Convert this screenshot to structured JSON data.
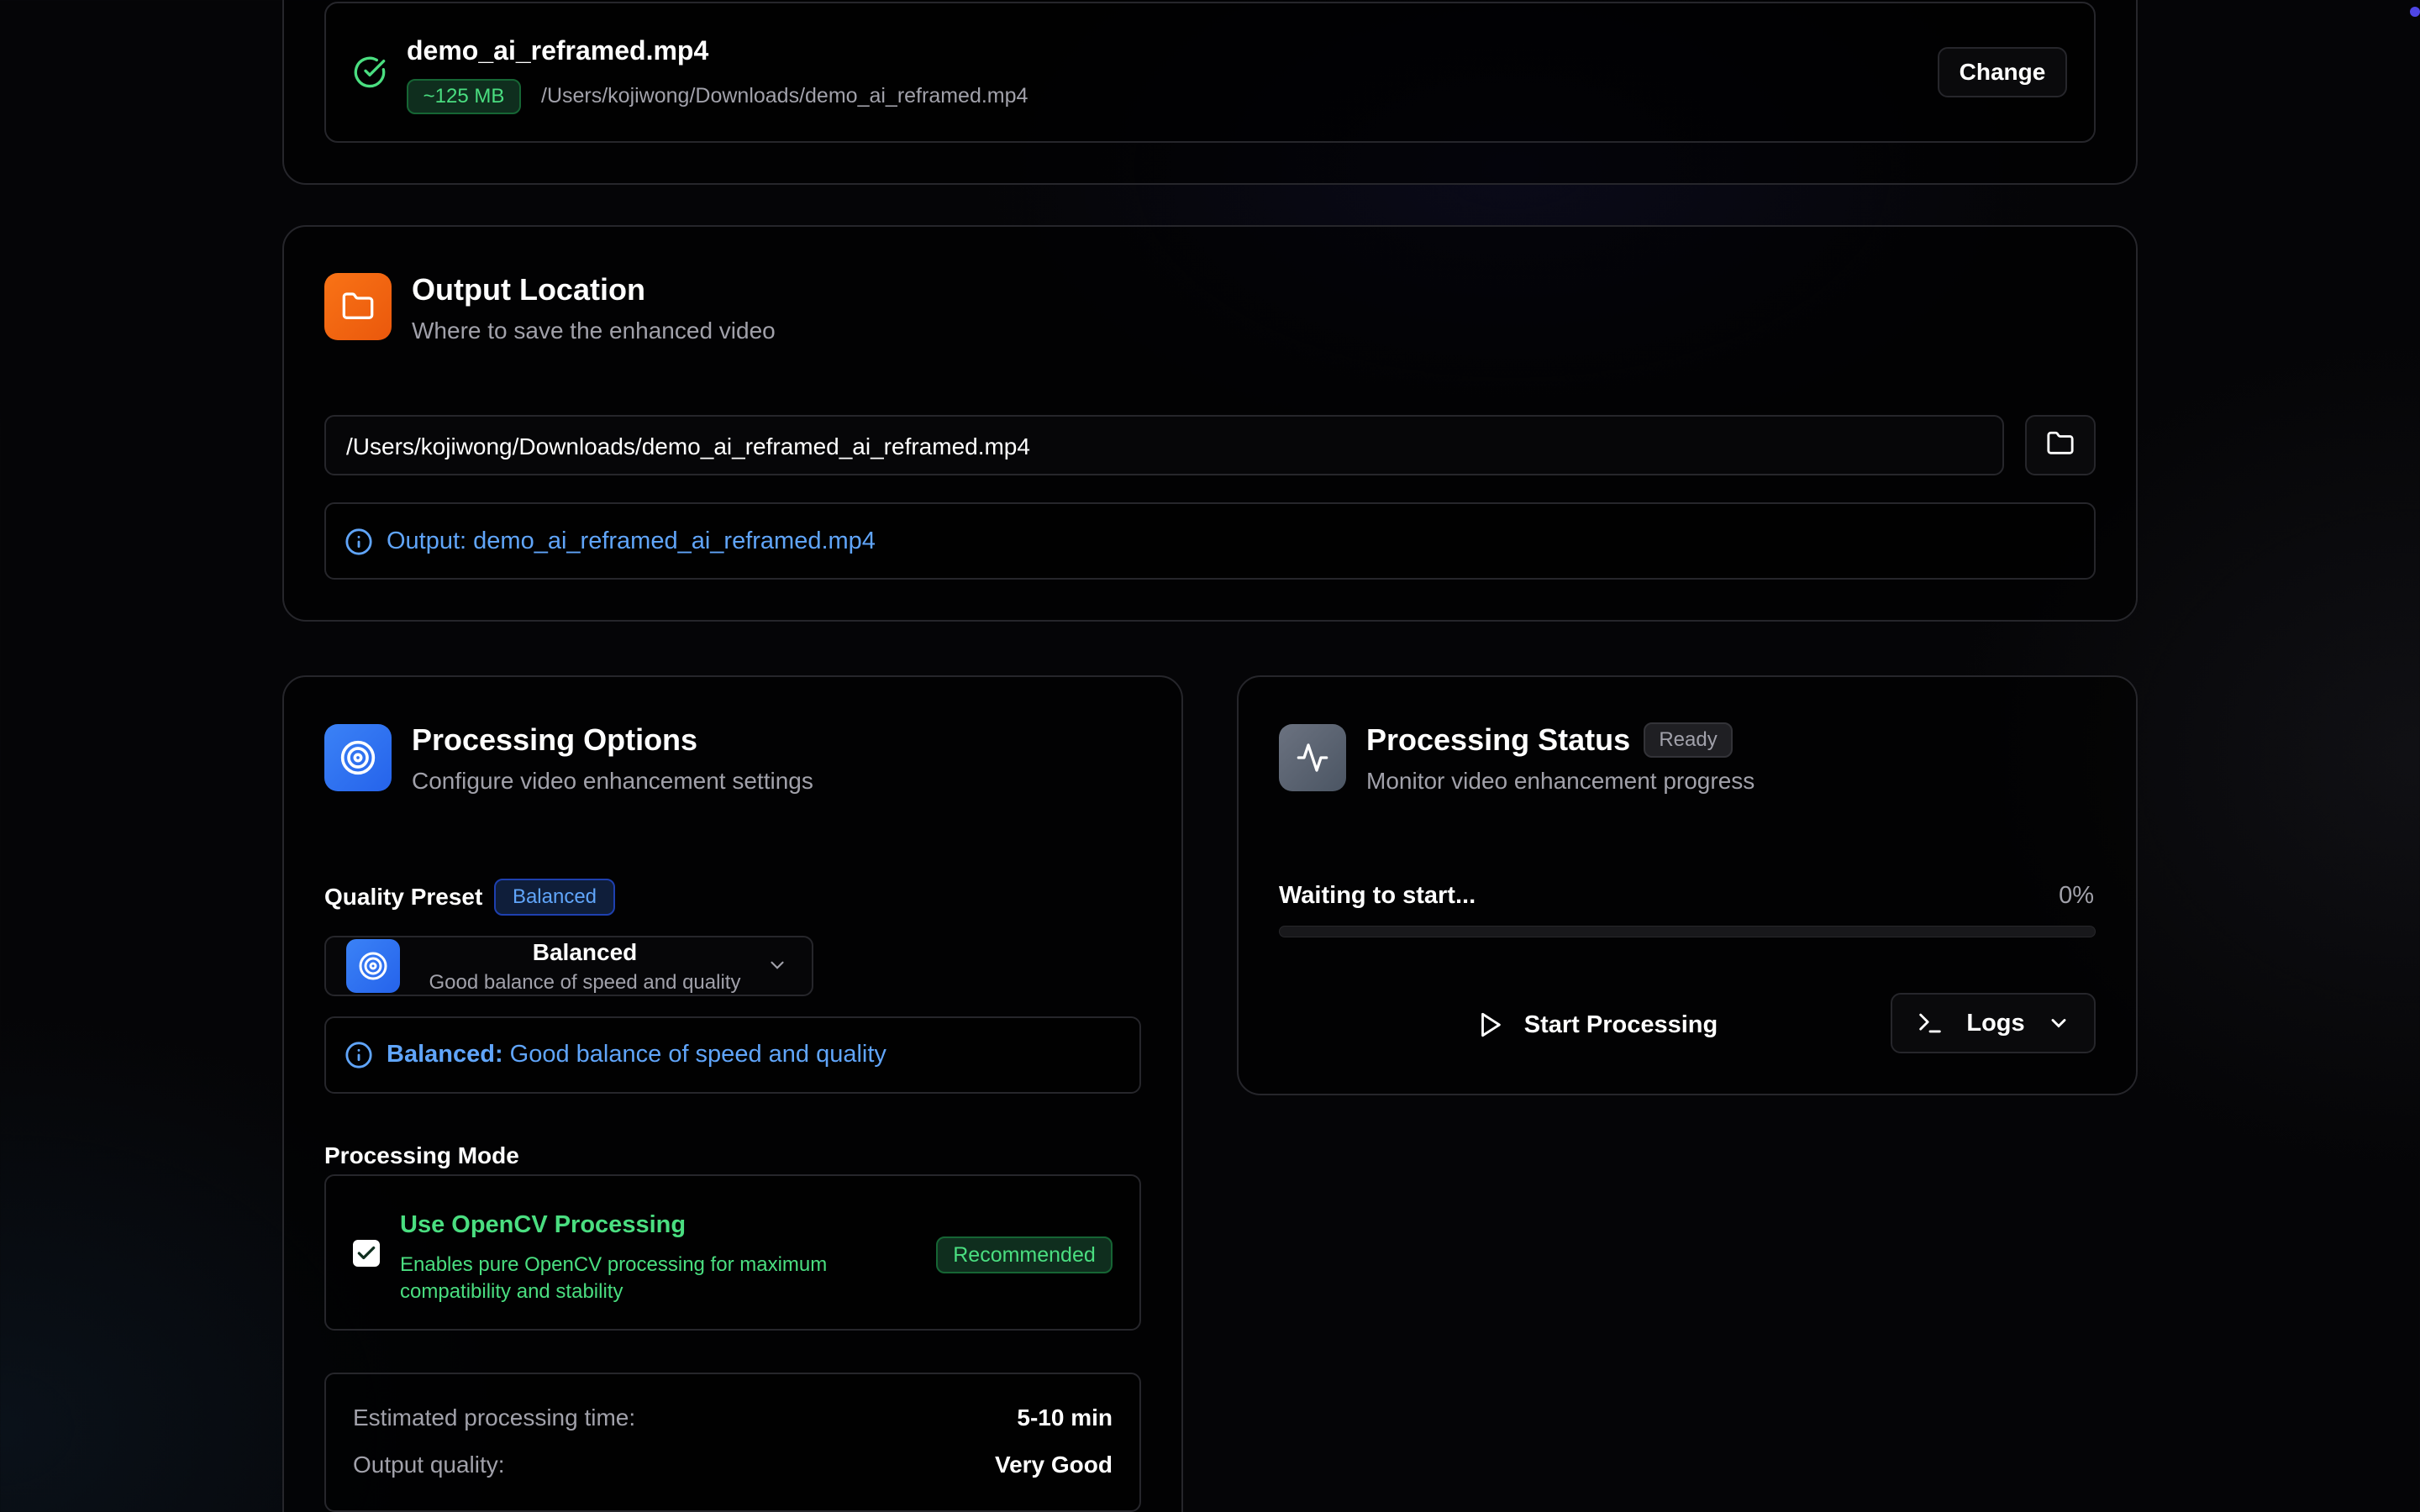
{
  "input_file": {
    "name": "demo_ai_reframed.mp4",
    "size_badge": "~125 MB",
    "path": "/Users/kojiwong/Downloads/demo_ai_reframed.mp4",
    "change_label": "Change"
  },
  "output": {
    "title": "Output Location",
    "subtitle": "Where to save the enhanced video",
    "path_value": "/Users/kojiwong/Downloads/demo_ai_reframed_ai_reframed.mp4",
    "info": "Output: demo_ai_reframed_ai_reframed.mp4"
  },
  "options": {
    "title": "Processing Options",
    "subtitle": "Configure video enhancement settings",
    "quality_label": "Quality Preset",
    "quality_badge": "Balanced",
    "select_title": "Balanced",
    "select_desc": "Good balance of speed and quality",
    "info_bold": "Balanced:",
    "info_text": "Good balance of speed and quality",
    "mode_label": "Processing Mode",
    "opencv_label": "Use OpenCV Processing",
    "opencv_desc_1": "Enables pure OpenCV processing for maximum",
    "opencv_desc_2": "compatibility and stability",
    "opencv_checked": true,
    "recommended": "Recommended",
    "est_time_label": "Estimated processing time:",
    "est_time_value": "5-10 min",
    "quality_out_label": "Output quality:",
    "quality_out_value": "Very Good"
  },
  "status": {
    "title": "Processing Status",
    "badge": "Ready",
    "subtitle": "Monitor video enhancement progress",
    "waiting": "Waiting to start...",
    "percent": "0%",
    "progress": 0,
    "start_label": "Start Processing",
    "logs_label": "Logs"
  },
  "colors": {
    "accent_green": "#4ade80",
    "accent_blue": "#60a5fa",
    "orange": "#f97316",
    "blue_icon": "#3b82f6"
  }
}
